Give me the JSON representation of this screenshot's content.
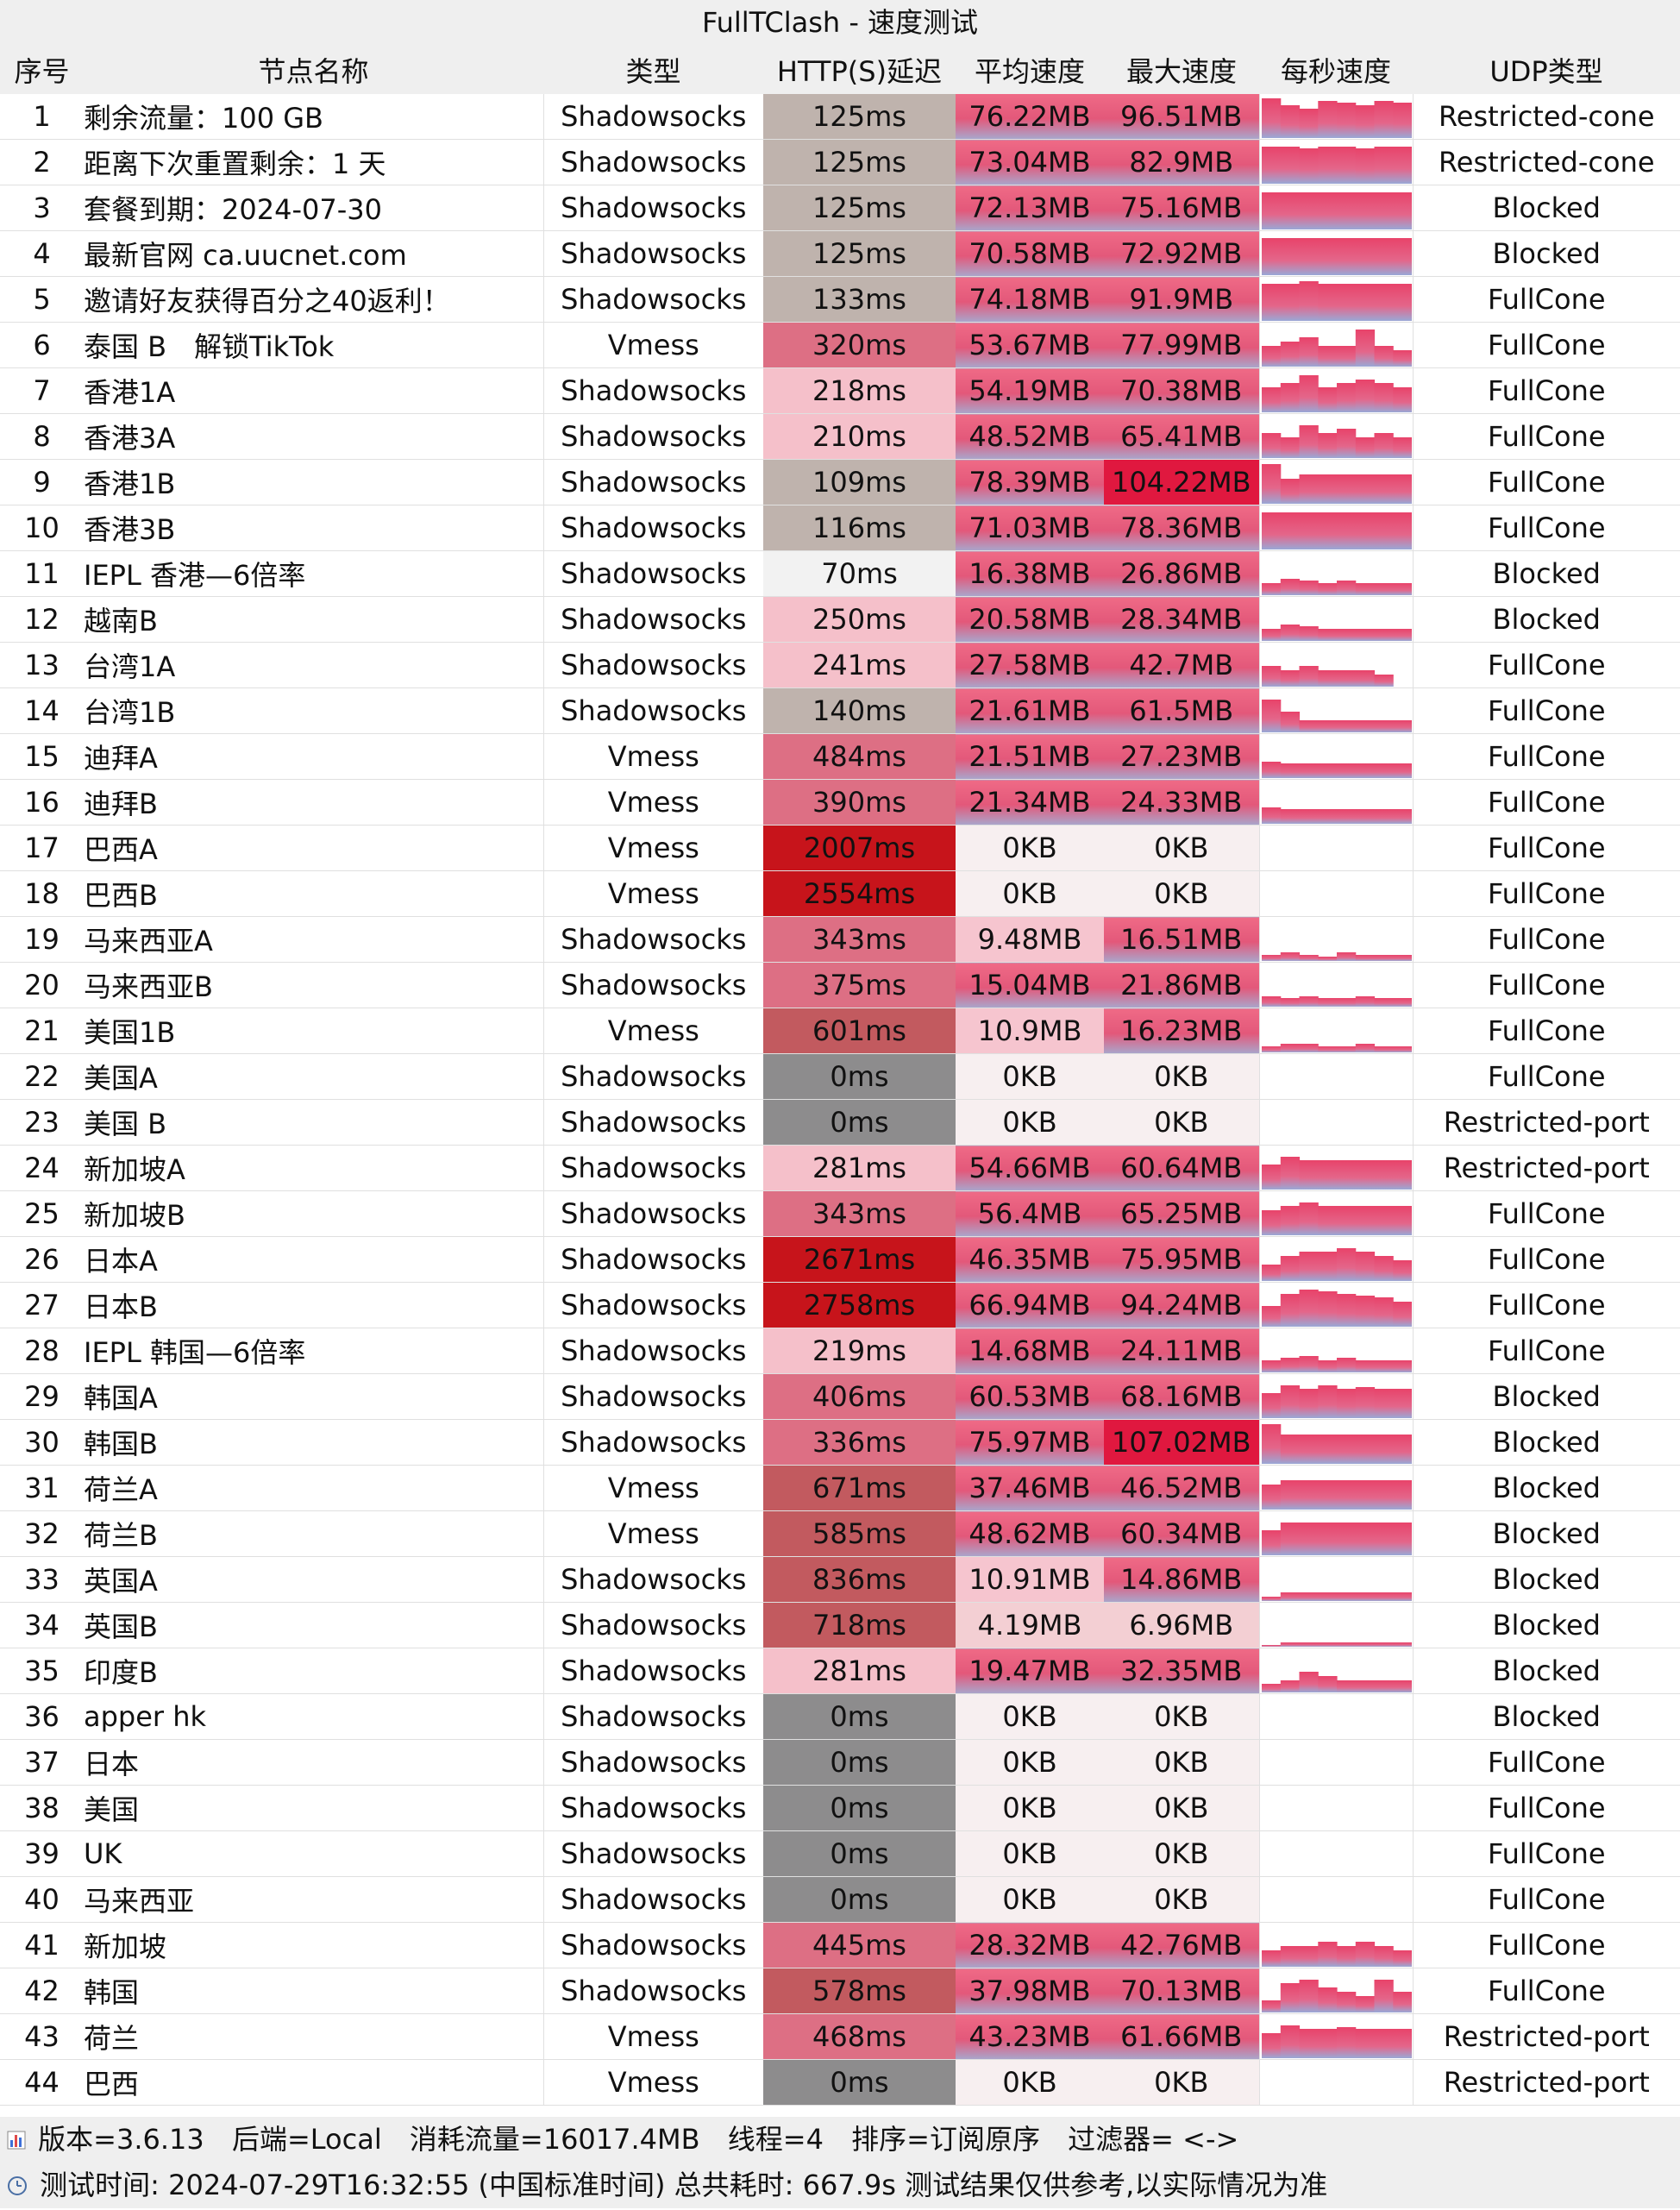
{
  "title": "FullTClash - 速度测试",
  "headers": [
    "序号",
    "节点名称",
    "类型",
    "HTTP(S)延迟",
    "平均速度",
    "最大速度",
    "每秒速度",
    "UDP类型"
  ],
  "rows": [
    {
      "idx": "1",
      "name": "剩余流量：100 GB",
      "type": "Shadowsocks",
      "delay": "125ms",
      "avg": "76.22MB",
      "max": "96.51MB",
      "udp": "Restricted-cone",
      "bars": [
        0.95,
        0.8,
        0.7,
        0.9,
        0.85,
        0.8,
        0.9,
        0.85
      ]
    },
    {
      "idx": "2",
      "name": "距离下次重置剩余：1 天",
      "type": "Shadowsocks",
      "delay": "125ms",
      "avg": "73.04MB",
      "max": "82.9MB",
      "udp": "Restricted-cone",
      "bars": [
        0.9,
        0.9,
        0.85,
        0.9,
        0.9,
        0.85,
        0.9,
        0.9
      ]
    },
    {
      "idx": "3",
      "name": "套餐到期：2024-07-30",
      "type": "Shadowsocks",
      "delay": "125ms",
      "avg": "72.13MB",
      "max": "75.16MB",
      "udp": "Blocked",
      "bars": [
        0.9,
        0.9,
        0.9,
        0.9,
        0.9,
        0.9,
        0.9,
        0.9
      ]
    },
    {
      "idx": "4",
      "name": "最新官网 ca.uucnet.com",
      "type": "Shadowsocks",
      "delay": "125ms",
      "avg": "70.58MB",
      "max": "72.92MB",
      "udp": "Blocked",
      "bars": [
        0.9,
        0.9,
        0.9,
        0.9,
        0.9,
        0.9,
        0.9,
        0.9
      ]
    },
    {
      "idx": "5",
      "name": "邀请好友获得百分之40返利！",
      "type": "Shadowsocks",
      "delay": "133ms",
      "avg": "74.18MB",
      "max": "91.9MB",
      "udp": "FullCone",
      "bars": [
        0.9,
        0.9,
        0.95,
        0.9,
        0.9,
        0.9,
        0.9,
        0.9
      ]
    },
    {
      "idx": "6",
      "name": "泰国 B　解锁TikTok",
      "type": "Vmess",
      "delay": "320ms",
      "avg": "53.67MB",
      "max": "77.99MB",
      "udp": "FullCone",
      "bars": [
        0.5,
        0.6,
        0.7,
        0.5,
        0.5,
        0.9,
        0.5,
        0.4
      ]
    },
    {
      "idx": "7",
      "name": "香港1A",
      "type": "Shadowsocks",
      "delay": "218ms",
      "avg": "54.19MB",
      "max": "70.38MB",
      "udp": "FullCone",
      "bars": [
        0.6,
        0.7,
        0.9,
        0.6,
        0.7,
        0.8,
        0.7,
        0.6
      ]
    },
    {
      "idx": "8",
      "name": "香港3A",
      "type": "Shadowsocks",
      "delay": "210ms",
      "avg": "48.52MB",
      "max": "65.41MB",
      "udp": "FullCone",
      "bars": [
        0.6,
        0.5,
        0.8,
        0.6,
        0.7,
        0.5,
        0.6,
        0.5
      ]
    },
    {
      "idx": "9",
      "name": "香港1B",
      "type": "Shadowsocks",
      "delay": "109ms",
      "avg": "78.39MB",
      "max": "104.22MB",
      "udp": "FullCone",
      "bars": [
        0.95,
        0.6,
        0.7,
        0.7,
        0.7,
        0.7,
        0.7,
        0.7
      ]
    },
    {
      "idx": "10",
      "name": "香港3B",
      "type": "Shadowsocks",
      "delay": "116ms",
      "avg": "71.03MB",
      "max": "78.36MB",
      "udp": "FullCone",
      "bars": [
        0.9,
        0.9,
        0.9,
        0.9,
        0.9,
        0.9,
        0.9,
        0.9
      ]
    },
    {
      "idx": "11",
      "name": "IEPL 香港—6倍率",
      "type": "Shadowsocks",
      "delay": "70ms",
      "avg": "16.38MB",
      "max": "26.86MB",
      "udp": "Blocked",
      "bars": [
        0.3,
        0.4,
        0.35,
        0.3,
        0.35,
        0.3,
        0.3,
        0.3
      ]
    },
    {
      "idx": "12",
      "name": "越南B",
      "type": "Shadowsocks",
      "delay": "250ms",
      "avg": "20.58MB",
      "max": "28.34MB",
      "udp": "Blocked",
      "bars": [
        0.3,
        0.4,
        0.35,
        0.3,
        0.3,
        0.3,
        0.3,
        0.3
      ]
    },
    {
      "idx": "13",
      "name": "台湾1A",
      "type": "Shadowsocks",
      "delay": "241ms",
      "avg": "27.58MB",
      "max": "42.7MB",
      "udp": "FullCone",
      "bars": [
        0.5,
        0.4,
        0.5,
        0.4,
        0.4,
        0.4,
        0.3,
        0
      ]
    },
    {
      "idx": "14",
      "name": "台湾1B",
      "type": "Shadowsocks",
      "delay": "140ms",
      "avg": "21.61MB",
      "max": "61.5MB",
      "udp": "FullCone",
      "bars": [
        0.8,
        0.5,
        0.3,
        0.3,
        0.3,
        0.3,
        0.3,
        0.3
      ]
    },
    {
      "idx": "15",
      "name": "迪拜A",
      "type": "Vmess",
      "delay": "484ms",
      "avg": "21.51MB",
      "max": "27.23MB",
      "udp": "FullCone",
      "bars": [
        0.4,
        0.35,
        0.35,
        0.35,
        0.35,
        0.35,
        0.35,
        0.35
      ]
    },
    {
      "idx": "16",
      "name": "迪拜B",
      "type": "Vmess",
      "delay": "390ms",
      "avg": "21.34MB",
      "max": "24.33MB",
      "udp": "FullCone",
      "bars": [
        0.4,
        0.35,
        0.35,
        0.35,
        0.35,
        0.35,
        0.35,
        0.35
      ]
    },
    {
      "idx": "17",
      "name": "巴西A",
      "type": "Vmess",
      "delay": "2007ms",
      "avg": "0KB",
      "max": "0KB",
      "udp": "FullCone",
      "bars": []
    },
    {
      "idx": "18",
      "name": "巴西B",
      "type": "Vmess",
      "delay": "2554ms",
      "avg": "0KB",
      "max": "0KB",
      "udp": "FullCone",
      "bars": []
    },
    {
      "idx": "19",
      "name": "马来西亚A",
      "type": "Shadowsocks",
      "delay": "343ms",
      "avg": "9.48MB",
      "max": "16.51MB",
      "udp": "FullCone",
      "bars": [
        0.15,
        0.2,
        0.15,
        0.1,
        0.2,
        0.15,
        0.15,
        0.15
      ]
    },
    {
      "idx": "20",
      "name": "马来西亚B",
      "type": "Shadowsocks",
      "delay": "375ms",
      "avg": "15.04MB",
      "max": "21.86MB",
      "udp": "FullCone",
      "bars": [
        0.25,
        0.2,
        0.25,
        0.2,
        0.2,
        0.25,
        0.2,
        0.2
      ]
    },
    {
      "idx": "21",
      "name": "美国1B",
      "type": "Vmess",
      "delay": "601ms",
      "avg": "10.9MB",
      "max": "16.23MB",
      "udp": "FullCone",
      "bars": [
        0.15,
        0.2,
        0.2,
        0.15,
        0.15,
        0.2,
        0.15,
        0.15
      ]
    },
    {
      "idx": "22",
      "name": "美国A",
      "type": "Shadowsocks",
      "delay": "0ms",
      "avg": "0KB",
      "max": "0KB",
      "udp": "FullCone",
      "bars": []
    },
    {
      "idx": "23",
      "name": "美国 B",
      "type": "Shadowsocks",
      "delay": "0ms",
      "avg": "0KB",
      "max": "0KB",
      "udp": "Restricted-port",
      "bars": []
    },
    {
      "idx": "24",
      "name": "新加坡A",
      "type": "Shadowsocks",
      "delay": "281ms",
      "avg": "54.66MB",
      "max": "60.64MB",
      "udp": "Restricted-port",
      "bars": [
        0.6,
        0.8,
        0.7,
        0.7,
        0.7,
        0.7,
        0.7,
        0.7
      ]
    },
    {
      "idx": "25",
      "name": "新加坡B",
      "type": "Shadowsocks",
      "delay": "343ms",
      "avg": "56.4MB",
      "max": "65.25MB",
      "udp": "FullCone",
      "bars": [
        0.6,
        0.7,
        0.8,
        0.7,
        0.7,
        0.7,
        0.7,
        0.7
      ]
    },
    {
      "idx": "26",
      "name": "日本A",
      "type": "Shadowsocks",
      "delay": "2671ms",
      "avg": "46.35MB",
      "max": "75.95MB",
      "udp": "FullCone",
      "bars": [
        0.4,
        0.6,
        0.7,
        0.7,
        0.8,
        0.7,
        0.6,
        0.5
      ]
    },
    {
      "idx": "27",
      "name": "日本B",
      "type": "Shadowsocks",
      "delay": "2758ms",
      "avg": "66.94MB",
      "max": "94.24MB",
      "udp": "FullCone",
      "bars": [
        0.5,
        0.8,
        0.9,
        0.85,
        0.8,
        0.75,
        0.7,
        0.6
      ]
    },
    {
      "idx": "28",
      "name": "IEPL 韩国—6倍率",
      "type": "Shadowsocks",
      "delay": "219ms",
      "avg": "14.68MB",
      "max": "24.11MB",
      "udp": "FullCone",
      "bars": [
        0.3,
        0.35,
        0.4,
        0.3,
        0.35,
        0.3,
        0.3,
        0.3
      ]
    },
    {
      "idx": "29",
      "name": "韩国A",
      "type": "Shadowsocks",
      "delay": "406ms",
      "avg": "60.53MB",
      "max": "68.16MB",
      "udp": "Blocked",
      "bars": [
        0.6,
        0.8,
        0.7,
        0.8,
        0.7,
        0.75,
        0.7,
        0.7
      ]
    },
    {
      "idx": "30",
      "name": "韩国B",
      "type": "Shadowsocks",
      "delay": "336ms",
      "avg": "75.97MB",
      "max": "107.02MB",
      "udp": "Blocked",
      "bars": [
        0.95,
        0.7,
        0.7,
        0.7,
        0.7,
        0.7,
        0.7,
        0.7
      ]
    },
    {
      "idx": "31",
      "name": "荷兰A",
      "type": "Vmess",
      "delay": "671ms",
      "avg": "37.46MB",
      "max": "46.52MB",
      "udp": "Blocked",
      "bars": [
        0.6,
        0.7,
        0.7,
        0.7,
        0.7,
        0.7,
        0.7,
        0.7
      ]
    },
    {
      "idx": "32",
      "name": "荷兰B",
      "type": "Vmess",
      "delay": "585ms",
      "avg": "48.62MB",
      "max": "60.34MB",
      "udp": "Blocked",
      "bars": [
        0.6,
        0.8,
        0.8,
        0.8,
        0.8,
        0.8,
        0.8,
        0.8
      ]
    },
    {
      "idx": "33",
      "name": "英国A",
      "type": "Shadowsocks",
      "delay": "836ms",
      "avg": "10.91MB",
      "max": "14.86MB",
      "udp": "Blocked",
      "bars": [
        0.1,
        0.2,
        0.2,
        0.2,
        0.2,
        0.2,
        0.2,
        0.2
      ]
    },
    {
      "idx": "34",
      "name": "英国B",
      "type": "Shadowsocks",
      "delay": "718ms",
      "avg": "4.19MB",
      "max": "6.96MB",
      "udp": "Blocked",
      "bars": [
        0.05,
        0.1,
        0.1,
        0.1,
        0.1,
        0.1,
        0.1,
        0.1
      ]
    },
    {
      "idx": "35",
      "name": "印度B",
      "type": "Shadowsocks",
      "delay": "281ms",
      "avg": "19.47MB",
      "max": "32.35MB",
      "udp": "Blocked",
      "bars": [
        0.2,
        0.3,
        0.5,
        0.4,
        0.3,
        0.3,
        0.3,
        0.3
      ]
    },
    {
      "idx": "36",
      "name": "apper hk",
      "type": "Shadowsocks",
      "delay": "0ms",
      "avg": "0KB",
      "max": "0KB",
      "udp": "Blocked",
      "bars": []
    },
    {
      "idx": "37",
      "name": "日本",
      "type": "Shadowsocks",
      "delay": "0ms",
      "avg": "0KB",
      "max": "0KB",
      "udp": "FullCone",
      "bars": []
    },
    {
      "idx": "38",
      "name": "美国",
      "type": "Shadowsocks",
      "delay": "0ms",
      "avg": "0KB",
      "max": "0KB",
      "udp": "FullCone",
      "bars": []
    },
    {
      "idx": "39",
      "name": "UK",
      "type": "Shadowsocks",
      "delay": "0ms",
      "avg": "0KB",
      "max": "0KB",
      "udp": "FullCone",
      "bars": []
    },
    {
      "idx": "40",
      "name": "马来西亚",
      "type": "Shadowsocks",
      "delay": "0ms",
      "avg": "0KB",
      "max": "0KB",
      "udp": "FullCone",
      "bars": []
    },
    {
      "idx": "41",
      "name": "新加坡",
      "type": "Shadowsocks",
      "delay": "445ms",
      "avg": "28.32MB",
      "max": "42.76MB",
      "udp": "FullCone",
      "bars": [
        0.4,
        0.5,
        0.5,
        0.6,
        0.5,
        0.6,
        0.5,
        0.4
      ]
    },
    {
      "idx": "42",
      "name": "韩国",
      "type": "Shadowsocks",
      "delay": "578ms",
      "avg": "37.98MB",
      "max": "70.13MB",
      "udp": "FullCone",
      "bars": [
        0.3,
        0.7,
        0.8,
        0.6,
        0.5,
        0.4,
        0.8,
        0.5
      ]
    },
    {
      "idx": "43",
      "name": "荷兰",
      "type": "Vmess",
      "delay": "468ms",
      "avg": "43.23MB",
      "max": "61.66MB",
      "udp": "Restricted-port",
      "bars": [
        0.6,
        0.8,
        0.7,
        0.7,
        0.75,
        0.7,
        0.7,
        0.7
      ]
    },
    {
      "idx": "44",
      "name": "巴西",
      "type": "Vmess",
      "delay": "0ms",
      "avg": "0KB",
      "max": "0KB",
      "udp": "Restricted-port",
      "bars": []
    }
  ],
  "footer": {
    "line1": [
      "版本=3.6.13",
      "后端=Local",
      "消耗流量=16017.4MB",
      "线程=4",
      "排序=订阅原序",
      "过滤器= <->"
    ],
    "line2": "测试时间: 2024-07-29T16:32:55 (中国标准时间) 总共耗时: 667.9s 测试结果仅供参考,以实际情况为准"
  },
  "colors": {
    "header_bg": "#efefef",
    "delay_gray": "#8d8c8d",
    "delay_white": "#f2f2f2",
    "delay_tan": "#bfb3ad",
    "delay_pink_light": "#f5c0ca",
    "delay_pink_mid": "#dd6f84",
    "delay_rose": "#c25a5f",
    "delay_red": "#c7141b",
    "speed_zero": "#f7eff0",
    "bar_top": "#e8436a",
    "bar_bottom": "#9aa8d6"
  }
}
